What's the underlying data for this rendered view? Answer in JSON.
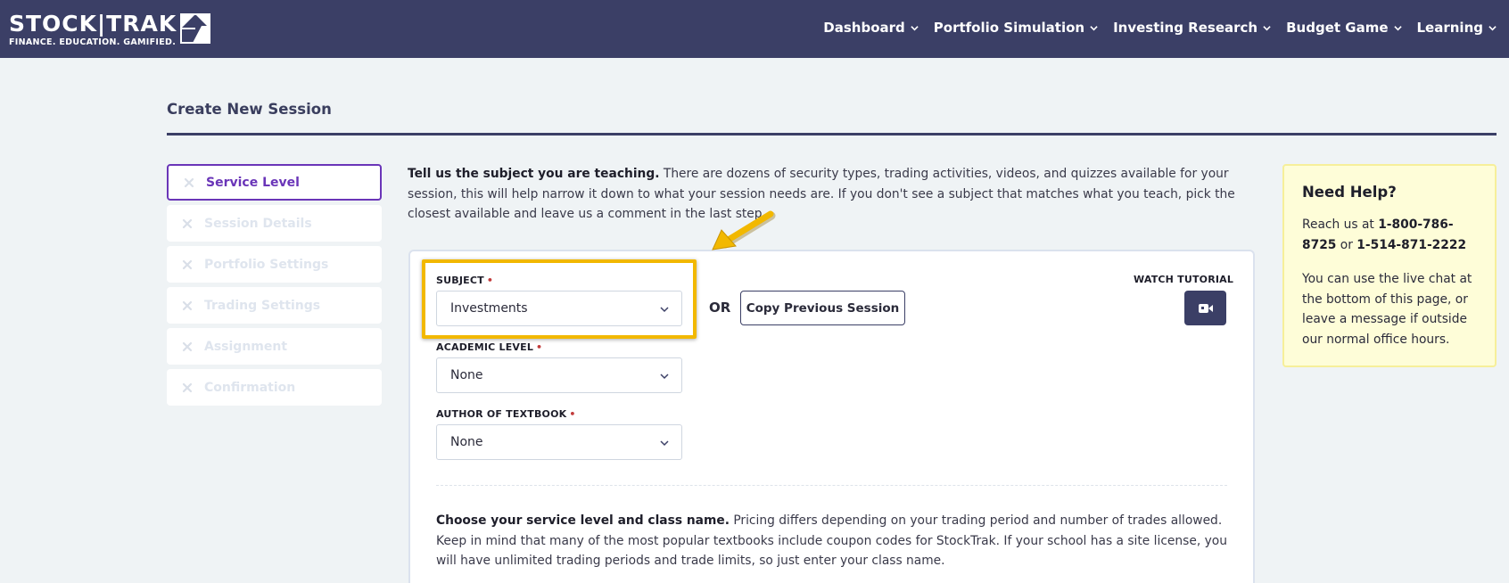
{
  "header": {
    "logo_word": "STOCK|TRAK",
    "logo_tagline": "FINANCE. EDUCATION. GAMIFIED.",
    "nav": [
      {
        "label": "Dashboard"
      },
      {
        "label": "Portfolio Simulation"
      },
      {
        "label": "Investing Research"
      },
      {
        "label": "Budget Game"
      },
      {
        "label": "Learning"
      }
    ]
  },
  "page": {
    "title": "Create New Session"
  },
  "steps": [
    {
      "label": "Service Level",
      "active": true
    },
    {
      "label": "Session Details",
      "active": false
    },
    {
      "label": "Portfolio Settings",
      "active": false
    },
    {
      "label": "Trading Settings",
      "active": false
    },
    {
      "label": "Assignment",
      "active": false
    },
    {
      "label": "Confirmation",
      "active": false
    }
  ],
  "intro": {
    "bold": "Tell us the subject you are teaching.",
    "text": " There are dozens of security types, trading activities, videos, and quizzes available for your session, this will help narrow it down to what your session needs are. If you don't see a subject that matches what you teach, pick the closest available and leave us a comment in the last step."
  },
  "form": {
    "subject": {
      "label": "SUBJECT",
      "value": "Investments"
    },
    "academic_level": {
      "label": "ACADEMIC LEVEL",
      "value": "None"
    },
    "textbook_author": {
      "label": "AUTHOR OF TEXTBOOK",
      "value": "None"
    },
    "required_mark": "•",
    "or_label": "OR",
    "copy_button": "Copy Previous Session",
    "watch_tutorial": "WATCH TUTORIAL"
  },
  "service": {
    "bold": "Choose your service level and class name.",
    "text": " Pricing differs depending on your trading period and number of trades allowed. Keep in mind that many of the most popular textbooks include coupon codes for StockTrak. If your school has a site license, you will have unlimited trading periods and trade limits, so just enter your class name."
  },
  "help": {
    "title": "Need Help?",
    "reach_prefix": "Reach us at ",
    "phone1": "1-800-786-8725",
    "reach_or": " or ",
    "phone2": "1-514-871-2222",
    "note": "You can use the live chat at the bottom of this page, or leave a message if outside our normal office hours."
  },
  "colors": {
    "header_bg": "#3b3f66",
    "accent_purple": "#6a35b8",
    "highlight_yellow": "#f2b800",
    "help_bg": "#fefdd8"
  }
}
